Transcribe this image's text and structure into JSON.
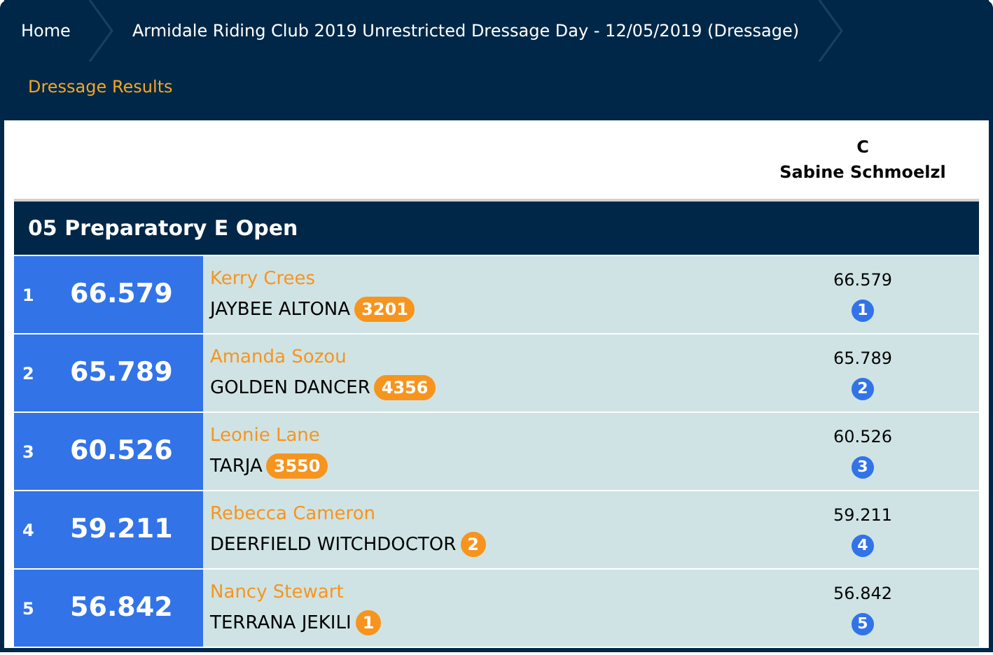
{
  "breadcrumbs": [
    {
      "label": "Home"
    },
    {
      "label": "Armidale Riding Club 2019 Unrestricted Dressage Day - 12/05/2019 (Dressage)"
    }
  ],
  "subnav": {
    "label": "Dressage Results"
  },
  "judge": {
    "position": "C",
    "name": "Sabine Schmoelzl"
  },
  "class_title": "05 Preparatory E Open",
  "results": [
    {
      "place": "1",
      "total": "66.579",
      "rider": "Kerry Crees",
      "horse": "JAYBEE ALTONA",
      "horse_badge": "3201",
      "judge_score": "66.579",
      "judge_rank": "1"
    },
    {
      "place": "2",
      "total": "65.789",
      "rider": "Amanda Sozou",
      "horse": "GOLDEN DANCER",
      "horse_badge": "4356",
      "judge_score": "65.789",
      "judge_rank": "2"
    },
    {
      "place": "3",
      "total": "60.526",
      "rider": "Leonie Lane",
      "horse": "TARJA",
      "horse_badge": "3550",
      "judge_score": "60.526",
      "judge_rank": "3"
    },
    {
      "place": "4",
      "total": "59.211",
      "rider": "Rebecca Cameron",
      "horse": "DEERFIELD WITCHDOCTOR",
      "horse_badge": "2",
      "judge_score": "59.211",
      "judge_rank": "4"
    },
    {
      "place": "5",
      "total": "56.842",
      "rider": "Nancy Stewart",
      "horse": "TERRANA JEKILI",
      "horse_badge": "1",
      "judge_score": "56.842",
      "judge_rank": "5"
    }
  ]
}
